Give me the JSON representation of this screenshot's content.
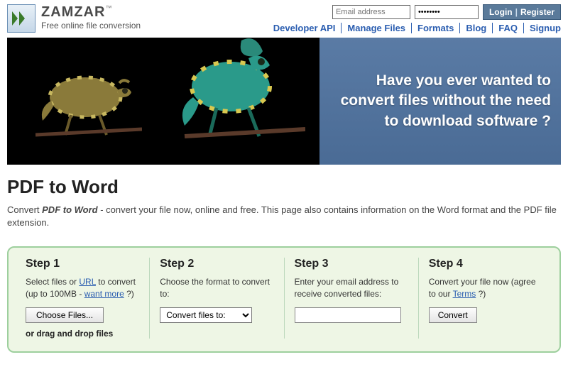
{
  "brand": {
    "name": "ZAMZAR",
    "tm": "™",
    "tagline": "Free online file conversion"
  },
  "login": {
    "email_placeholder": "Email address",
    "password_value": "••••••••",
    "login_label": "Login",
    "register_label": "Register"
  },
  "nav": {
    "items": [
      "Developer API",
      "Manage Files",
      "Formats",
      "Blog",
      "FAQ",
      "Signup"
    ]
  },
  "hero": {
    "line1": "Have you ever wanted to",
    "line2": "convert files without the need",
    "line3": "to download software ?"
  },
  "page": {
    "title": "PDF to Word",
    "desc_prefix": "Convert ",
    "desc_em": "PDF to Word",
    "desc_rest": " - convert your file now, online and free. This page also contains information on the Word format and the PDF file extension."
  },
  "steps": {
    "s1": {
      "title": "Step 1",
      "desc_a": "Select files or ",
      "url_link": "URL",
      "desc_b": " to convert (up to 100MB - ",
      "want_more": "want more",
      "desc_c": " ?)",
      "choose_label": "Choose Files...",
      "dragdrop": "or drag and drop files"
    },
    "s2": {
      "title": "Step 2",
      "desc": "Choose the format to convert to:",
      "select_label": "Convert files to:"
    },
    "s3": {
      "title": "Step 3",
      "desc": "Enter your email address to receive converted files:"
    },
    "s4": {
      "title": "Step 4",
      "desc_a": "Convert your file now (agree to our ",
      "terms": "Terms",
      "desc_b": " ?)",
      "convert_label": "Convert"
    }
  }
}
